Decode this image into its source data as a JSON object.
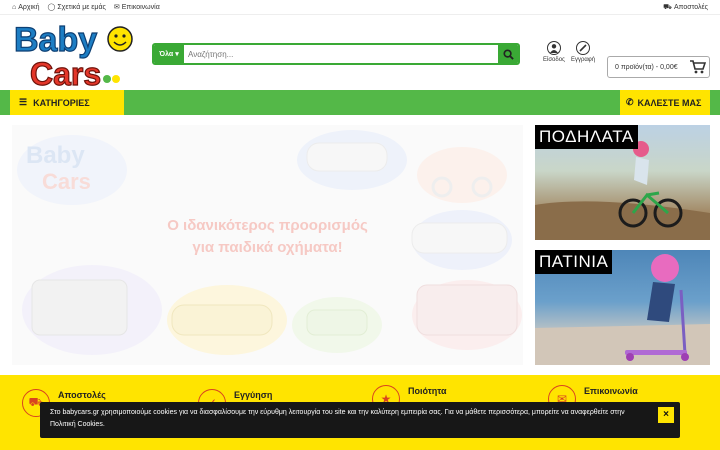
{
  "topbar": {
    "home": "Αρχική",
    "about": "Σχετικά με εμάς",
    "contact": "Επικοινωνία",
    "shipping": "Αποστολές"
  },
  "logo": {
    "line1": "Baby",
    "line2": "Cars"
  },
  "search": {
    "category": "Όλα",
    "placeholder": "Αναζήτηση..."
  },
  "account": {
    "login": "Είσοδος",
    "register": "Εγγραφή"
  },
  "cart": {
    "label": "0 προϊόν(τα) - 0,00€"
  },
  "nav": {
    "categories": "ΚΑΤΗΓΟΡΙΕΣ",
    "call": "ΚΑΛΕΣΤΕ ΜΑΣ"
  },
  "banner": {
    "line1": "Ο ιδανικότερος προορισμός",
    "line2": "για παιδικά οχήματα!"
  },
  "tiles": {
    "bikes": "ΠΟΔΗΛΑΤΑ",
    "scooters": "ΠΑΤΙΝΙΑ"
  },
  "features": [
    {
      "title": "Αποστολές"
    },
    {
      "title": "Εγγύηση"
    },
    {
      "title": "Ποιότητα"
    },
    {
      "title": "Επικοινωνία"
    }
  ],
  "cookie": {
    "text": "Στο babycars.gr χρησιμοποιούμε cookies για να διασφαλίσουμε την εύρυθμη λειτουργία του site και την καλύτερη εμπειρία σας. Για να μάθετε περισσότερα, μπορείτε να αναφερθείτε στην Πολιτική Cookies.",
    "close": "×"
  },
  "colors": {
    "green": "#54b848",
    "yellow": "#ffe400",
    "accent": "#d9441f"
  }
}
